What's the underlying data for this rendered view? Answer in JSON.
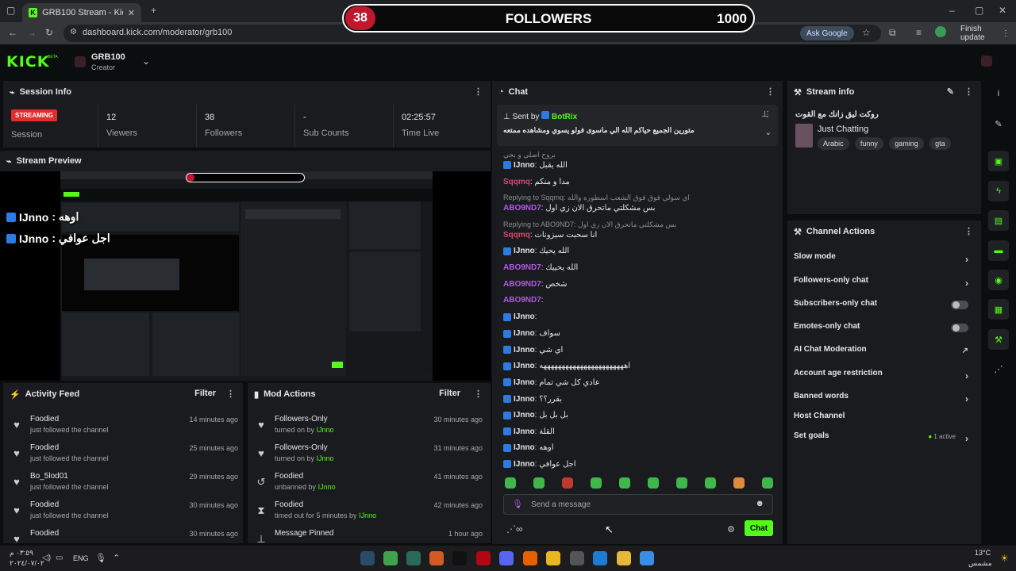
{
  "browser": {
    "tab_title": "GRB100 Stream - Kick Dashboard",
    "url": "dashboard.kick.com/moderator/grb100",
    "ask_google": "Ask Google",
    "finish_update": "Finish update"
  },
  "overlay": {
    "count": "38",
    "title": "FOLLOWERS",
    "goal": "1000"
  },
  "header": {
    "logo": "KICK",
    "logo_tag": "BETA",
    "channel_name": "GRB100",
    "channel_role": "Creator"
  },
  "session": {
    "title": "Session Info",
    "status": "STREAMING",
    "status_label": "Session",
    "stats": [
      {
        "value": "12",
        "label": "Viewers"
      },
      {
        "value": "38",
        "label": "Followers"
      },
      {
        "value": "-",
        "label": "Sub Counts"
      },
      {
        "value": "02:25:57",
        "label": "Time Live"
      }
    ]
  },
  "preview": {
    "title": "Stream Preview",
    "overlay_lines": [
      {
        "user": "IJnno",
        "text": ": اوهه"
      },
      {
        "user": "IJnno",
        "text": ": اجل عوافي"
      }
    ]
  },
  "activity": {
    "title": "Activity Feed",
    "filter": "Filter",
    "items": [
      {
        "name": "Foodied",
        "desc": "just followed the channel",
        "time": "14 minutes ago"
      },
      {
        "name": "Foodied",
        "desc": "just followed the channel",
        "time": "25 minutes ago"
      },
      {
        "name": "Bo_5lod01",
        "desc": "just followed the channel",
        "time": "29 minutes ago"
      },
      {
        "name": "Foodied",
        "desc": "just followed the channel",
        "time": "30 minutes ago"
      },
      {
        "name": "Foodied",
        "desc": "",
        "time": "30 minutes ago"
      }
    ]
  },
  "mod": {
    "title": "Mod Actions",
    "filter": "Filter",
    "items": [
      {
        "name": "Followers-Only",
        "desc_prefix": "turned on by ",
        "desc_user": "IJnno",
        "time": "30 minutes ago"
      },
      {
        "name": "Followers-Only",
        "desc_prefix": "turned on by ",
        "desc_user": "IJnno",
        "time": "31 minutes ago"
      },
      {
        "name": "Foodied",
        "desc_prefix": "unbanned by ",
        "desc_user": "IJnno",
        "time": "41 minutes ago"
      },
      {
        "name": "Foodied",
        "desc_prefix": "timed out for 5 minutes by ",
        "desc_user": "IJnno",
        "time": "42 minutes ago"
      },
      {
        "name": "Message Pinned",
        "desc_prefix": "",
        "desc_user": "",
        "time": "1 hour ago"
      }
    ]
  },
  "chat": {
    "title": "Chat",
    "pinned_by_label": "Sent by",
    "pinned_user": "BotRix",
    "pinned_message": "متورين الجميع حياكم الله الي ماسوى فولو يسوي ومشاهده ممتعه",
    "messages": [
      {
        "reply": "بروح اصلي و بجي",
        "user": "IJnno",
        "color": "#e6e6e6",
        "text": ": الله يقبل"
      },
      {
        "reply": "",
        "user": "Sqqmq",
        "color": "#e0446b",
        "text": ": مدا و منكم"
      },
      {
        "reply": "Replying to Sqqmq: اي سولي فوق فوق الشعب اسطوره والله",
        "user": "ABO9ND7",
        "color": "#b05ae6",
        "text": ": بس مشكلتي ماتحرق الان زي اول"
      },
      {
        "reply": "Replying to ABO9ND7: بس مشكلتي ماتحرق الان زي اول",
        "user": "Sqqmq",
        "color": "#e0446b",
        "text": ": انا سحبت سيزونات"
      },
      {
        "reply": "",
        "user": "IJnno",
        "color": "#e6e6e6",
        "text": ": الله يحيك"
      },
      {
        "reply": "",
        "user": "ABO9ND7",
        "color": "#b05ae6",
        "text": ": الله يحييك"
      },
      {
        "reply": "",
        "user": "ABO9ND7",
        "color": "#b05ae6",
        "text": ": شخص"
      },
      {
        "reply": "",
        "user": "ABO9ND7",
        "color": "#b05ae6",
        "text": ":"
      },
      {
        "reply": "",
        "user": "IJnno",
        "color": "#e6e6e6",
        "text": ":"
      },
      {
        "reply": "",
        "user": "IJnno",
        "color": "#e6e6e6",
        "text": ": سواف"
      },
      {
        "reply": "",
        "user": "IJnno",
        "color": "#e6e6e6",
        "text": ": اي شي"
      },
      {
        "reply": "",
        "user": "IJnno",
        "color": "#e6e6e6",
        "text": ": اهههههههههههههههههههههههه"
      },
      {
        "reply": "",
        "user": "IJnno",
        "color": "#e6e6e6",
        "text": ": عادي كل شي تمام"
      },
      {
        "reply": "",
        "user": "IJnno",
        "color": "#e6e6e6",
        "text": ": بقرر؟؟"
      },
      {
        "reply": "",
        "user": "IJnno",
        "color": "#e6e6e6",
        "text": ": بل بل بل"
      },
      {
        "reply": "",
        "user": "IJnno",
        "color": "#e6e6e6",
        "text": ": القلة"
      },
      {
        "reply": "",
        "user": "IJnno",
        "color": "#e6e6e6",
        "text": ": اوهه"
      },
      {
        "reply": "",
        "user": "IJnno",
        "color": "#e6e6e6",
        "text": ": اجل عوافي"
      }
    ],
    "input_placeholder": "Send a message",
    "send_label": "Chat"
  },
  "stream_info": {
    "title": "Stream info",
    "stream_title": "روكت ليق زانك مع القوت",
    "category": "Just Chatting",
    "tags": [
      "Arabic",
      "funny",
      "gaming",
      "gta"
    ]
  },
  "channel_actions": {
    "title": "Channel Actions",
    "rows": [
      {
        "label": "Slow mode",
        "control": "chevron"
      },
      {
        "label": "Followers-only chat",
        "control": "chevron"
      },
      {
        "label": "Subscribers-only chat",
        "control": "toggle"
      },
      {
        "label": "Emotes-only chat",
        "control": "toggle"
      },
      {
        "label": "AI Chat Moderation",
        "control": "external"
      },
      {
        "label": "Account age restriction",
        "control": "chevron"
      },
      {
        "label": "Banned words",
        "control": "chevron"
      },
      {
        "label": "Host Channel",
        "control": "none"
      },
      {
        "label": "Set goals",
        "control": "chevron"
      }
    ],
    "goals_status": "1 active"
  },
  "taskbar": {
    "time": "٠٣:٥٩ م",
    "date": "٢٠٢٤/٠٧/٠٢",
    "lang": "ENG",
    "weather_temp": "13°C",
    "weather_desc": "مشمس"
  }
}
